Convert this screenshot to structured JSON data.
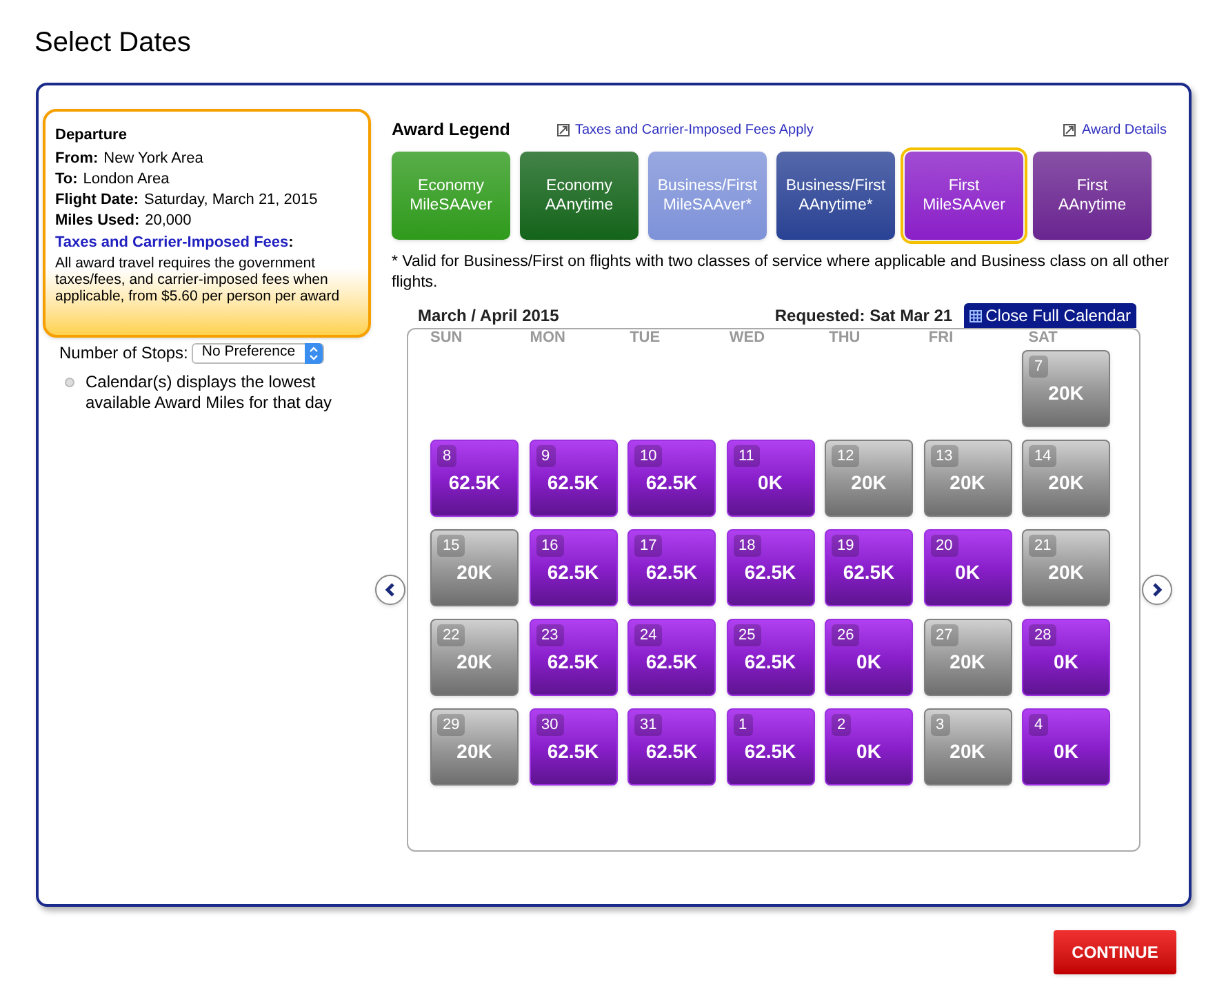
{
  "page_title": "Select Dates",
  "departure": {
    "heading": "Departure",
    "fields": [
      {
        "label": "From:",
        "value": "New York Area"
      },
      {
        "label": "To:",
        "value": "London Area"
      },
      {
        "label": "Flight Date:",
        "value": "Saturday, March 21, 2015"
      },
      {
        "label": "Miles Used:",
        "value": "20,000"
      }
    ],
    "fees_link": "Taxes and Carrier-Imposed Fees",
    "fees_colon": ":",
    "fees_text": "All award travel requires the government taxes/fees, and carrier-imposed fees when applicable, from $5.60 per person per award"
  },
  "stops": {
    "label": "Number of Stops:",
    "value": "No Preference"
  },
  "calendar_note": "Calendar(s) displays the lowest available Award Miles for that day",
  "legend": {
    "title": "Award Legend",
    "fees_link": "Taxes and Carrier-Imposed Fees Apply",
    "details_link": "Award Details",
    "items": [
      {
        "line1": "Economy",
        "line2": "MileSAAver",
        "color": "#2f9a1c",
        "selected": false
      },
      {
        "line1": "Economy",
        "line2": "AAnytime",
        "color": "#14641a",
        "selected": false
      },
      {
        "line1": "Business/First",
        "line2": "MileSAAver*",
        "color": "#7e92d8",
        "selected": false
      },
      {
        "line1": "Business/First",
        "line2": "AAnytime*",
        "color": "#2a4294",
        "selected": false
      },
      {
        "line1": "First",
        "line2": "MileSAAver",
        "color": "#8a1fc8",
        "selected": true
      },
      {
        "line1": "First",
        "line2": "AAnytime",
        "color": "#6a2590",
        "selected": false
      }
    ],
    "footnote": "* Valid for Business/First on flights with two classes of service where applicable and Business class on all other flights."
  },
  "calendar": {
    "month": "March / April 2015",
    "requested": "Requested: Sat Mar 21",
    "close_button": "Close Full Calendar",
    "weekdays": [
      "SUN",
      "MON",
      "TUE",
      "WED",
      "THU",
      "FRI",
      "SAT"
    ],
    "weeks": [
      {
        "cells": [
          {
            "kind": "empty"
          },
          {
            "kind": "empty"
          },
          {
            "kind": "empty"
          },
          {
            "kind": "empty"
          },
          {
            "kind": "empty"
          },
          {
            "kind": "empty"
          },
          {
            "kind": "gray",
            "day": "7",
            "miles": "20K"
          }
        ]
      },
      {
        "cells": [
          {
            "kind": "purple",
            "day": "8",
            "miles": "62.5K"
          },
          {
            "kind": "purple",
            "day": "9",
            "miles": "62.5K"
          },
          {
            "kind": "purple",
            "day": "10",
            "miles": "62.5K"
          },
          {
            "kind": "purple",
            "day": "11",
            "miles": "0K"
          },
          {
            "kind": "gray",
            "day": "12",
            "miles": "20K"
          },
          {
            "kind": "gray",
            "day": "13",
            "miles": "20K"
          },
          {
            "kind": "gray",
            "day": "14",
            "miles": "20K"
          }
        ]
      },
      {
        "cells": [
          {
            "kind": "gray",
            "day": "15",
            "miles": "20K"
          },
          {
            "kind": "purple",
            "day": "16",
            "miles": "62.5K"
          },
          {
            "kind": "purple",
            "day": "17",
            "miles": "62.5K"
          },
          {
            "kind": "purple",
            "day": "18",
            "miles": "62.5K"
          },
          {
            "kind": "purple",
            "day": "19",
            "miles": "62.5K"
          },
          {
            "kind": "purple",
            "day": "20",
            "miles": "0K"
          },
          {
            "kind": "gray",
            "day": "21",
            "miles": "20K"
          }
        ]
      },
      {
        "cells": [
          {
            "kind": "gray",
            "day": "22",
            "miles": "20K"
          },
          {
            "kind": "purple",
            "day": "23",
            "miles": "62.5K"
          },
          {
            "kind": "purple",
            "day": "24",
            "miles": "62.5K"
          },
          {
            "kind": "purple",
            "day": "25",
            "miles": "62.5K"
          },
          {
            "kind": "purple",
            "day": "26",
            "miles": "0K"
          },
          {
            "kind": "gray",
            "day": "27",
            "miles": "20K"
          },
          {
            "kind": "purple",
            "day": "28",
            "miles": "0K"
          }
        ]
      },
      {
        "cells": [
          {
            "kind": "gray",
            "day": "29",
            "miles": "20K"
          },
          {
            "kind": "purple",
            "day": "30",
            "miles": "62.5K"
          },
          {
            "kind": "purple",
            "day": "31",
            "miles": "62.5K"
          },
          {
            "kind": "purple",
            "day": "1",
            "miles": "62.5K"
          },
          {
            "kind": "purple",
            "day": "2",
            "miles": "0K"
          },
          {
            "kind": "gray",
            "day": "3",
            "miles": "20K"
          },
          {
            "kind": "purple",
            "day": "4",
            "miles": "0K"
          }
        ]
      }
    ]
  },
  "continue_button": "CONTINUE"
}
